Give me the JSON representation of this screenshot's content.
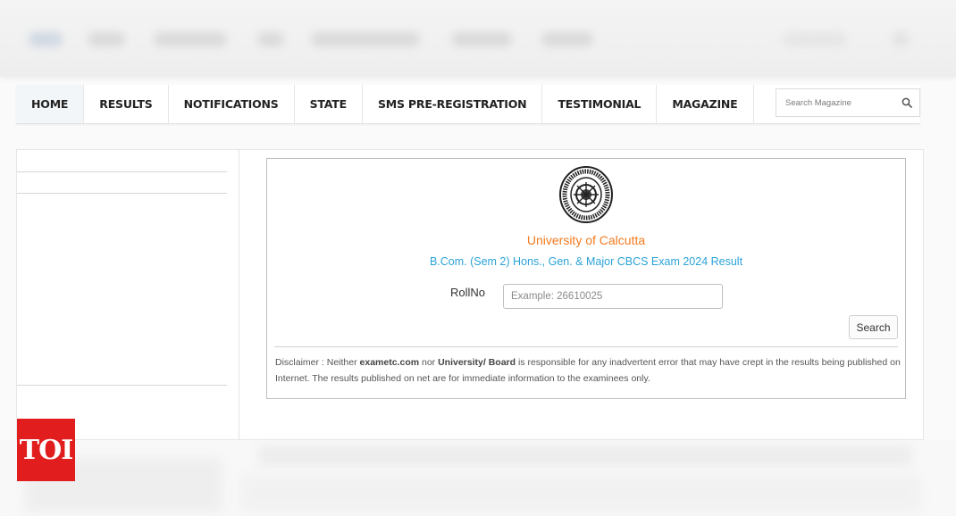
{
  "nav": {
    "items": [
      {
        "label": "HOME",
        "active": true
      },
      {
        "label": "RESULTS"
      },
      {
        "label": "NOTIFICATIONS"
      },
      {
        "label": "STATE"
      },
      {
        "label": "SMS PRE-REGISTRATION"
      },
      {
        "label": "TESTIMONIAL"
      },
      {
        "label": "MAGAZINE"
      }
    ],
    "search_placeholder": "Search Magazine",
    "search_icon": "search-icon"
  },
  "result": {
    "seal_icon": "university-seal-icon",
    "university": "University of Calcutta",
    "exam": "B.Com. (Sem 2) Hons., Gen. & Major CBCS Exam 2024 Result",
    "roll_label": "RollNo",
    "roll_placeholder": "Example: 26610025",
    "search_button": "Search",
    "disclaimer": {
      "prefix": "Disclaimer : Neither ",
      "site": "exametc.com",
      "mid": " nor ",
      "board": "University/ Board",
      "suffix": " is responsible for any inadvertent error that may have crept in the results being published on Internet. The results published on net are for immediate information to the examinees only."
    }
  },
  "watermark": {
    "label": "TOI",
    "color": "#e11d1d"
  },
  "colors": {
    "university": "#f47a1f",
    "exam": "#2aa3d8"
  }
}
